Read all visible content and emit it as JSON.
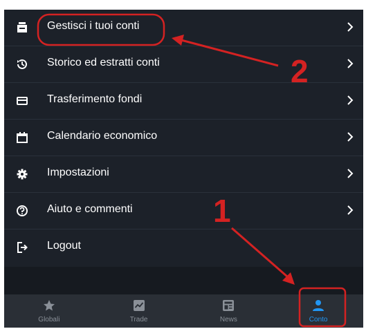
{
  "menu": {
    "items": [
      {
        "label": "Gestisci i tuoi conti",
        "icon": "wallet-icon"
      },
      {
        "label": "Storico ed estratti conti",
        "icon": "history-icon"
      },
      {
        "label": "Trasferimento fondi",
        "icon": "credit-card-icon"
      },
      {
        "label": "Calendario economico",
        "icon": "calendar-icon"
      },
      {
        "label": "Impostazioni",
        "icon": "gear-icon"
      },
      {
        "label": "Aiuto e commenti",
        "icon": "help-icon"
      },
      {
        "label": "Logout",
        "icon": "logout-icon"
      }
    ]
  },
  "tabbar": {
    "tabs": [
      {
        "label": "Globali",
        "icon": "star-icon"
      },
      {
        "label": "Trade",
        "icon": "chart-icon"
      },
      {
        "label": "News",
        "icon": "news-icon"
      },
      {
        "label": "Conto",
        "icon": "user-icon",
        "active": true
      }
    ]
  },
  "annotations": {
    "step_1": "1",
    "step_2": "2"
  },
  "colors": {
    "background": "#1c2129",
    "tabbar": "#2a2f36",
    "accent": "#2196f3",
    "annotation": "#d42222"
  }
}
